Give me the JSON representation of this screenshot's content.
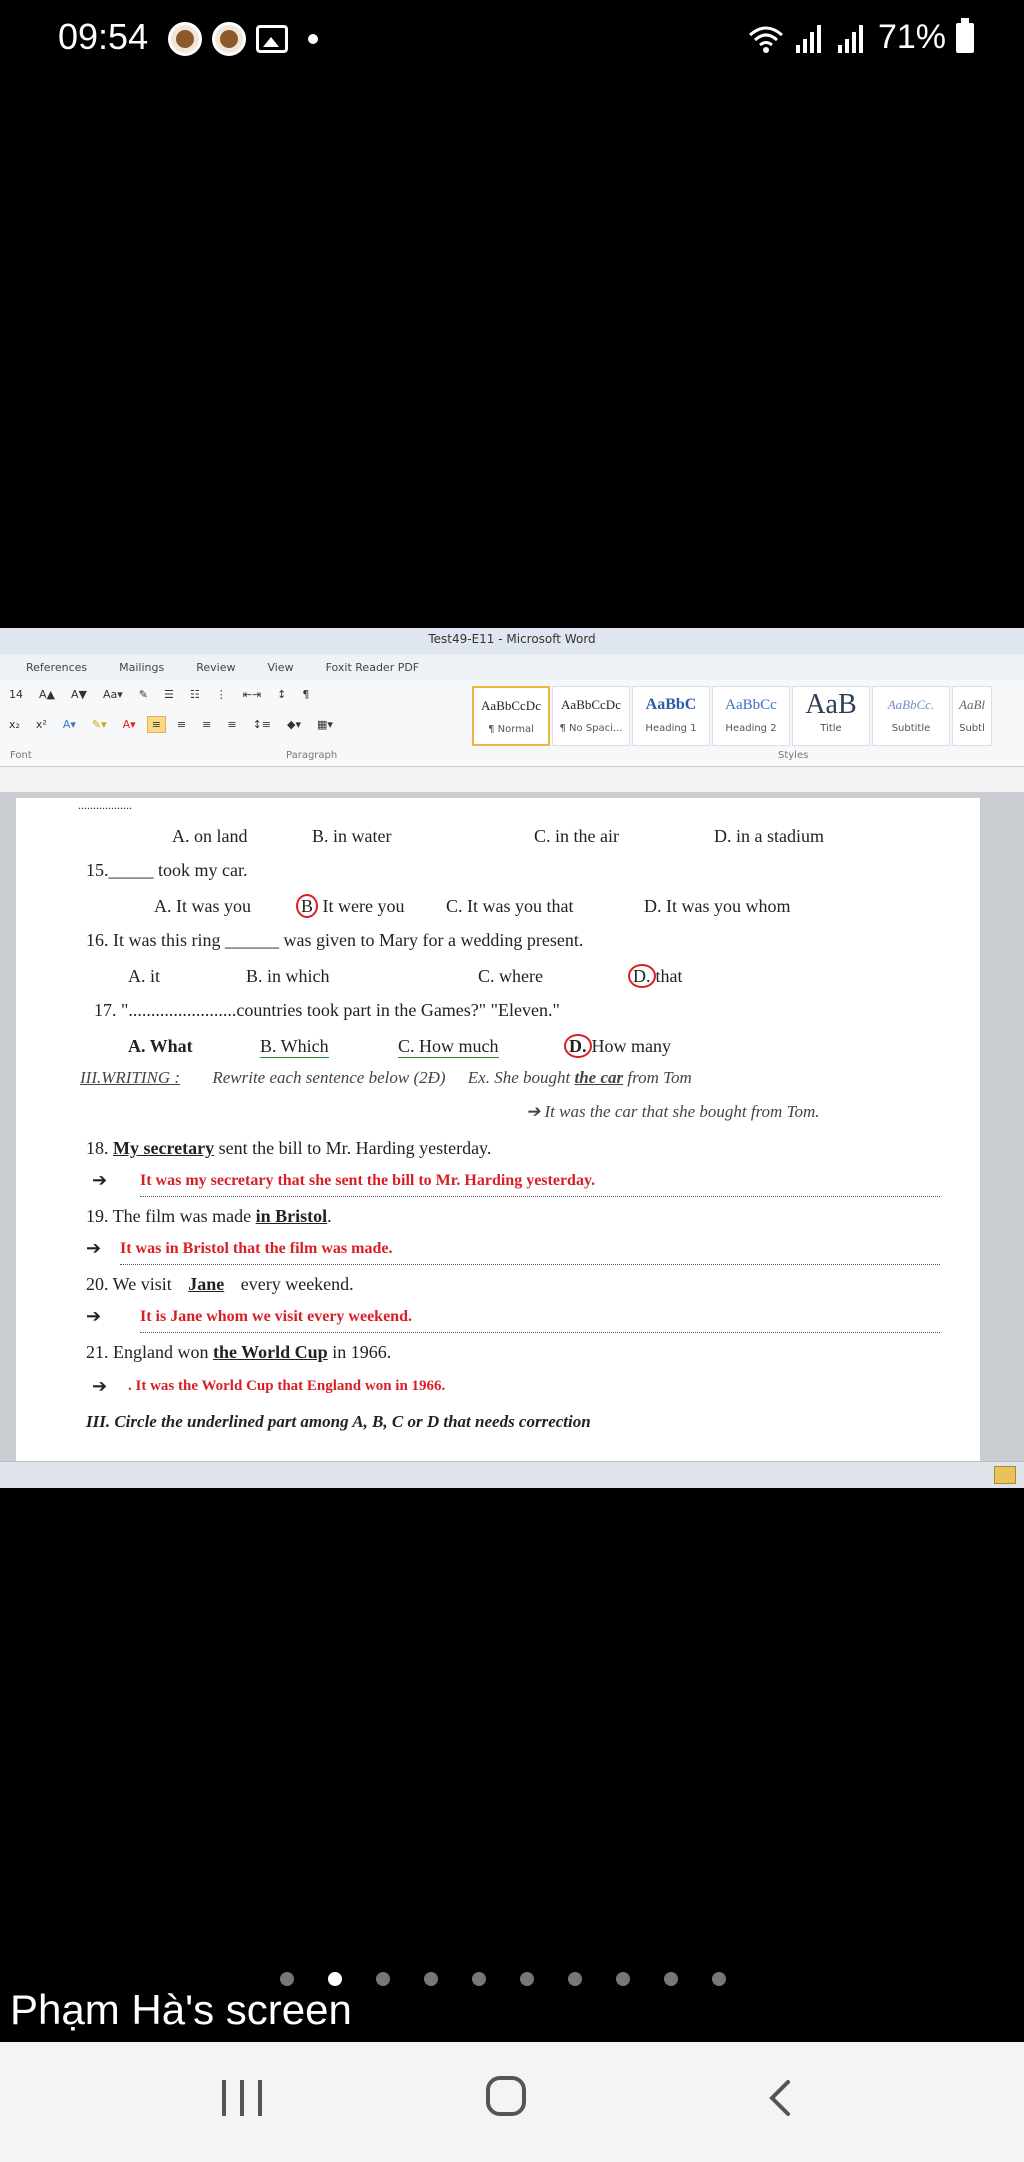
{
  "status": {
    "time": "09:54",
    "battery": "71%"
  },
  "window": {
    "title": "Test49-E11 - Microsoft Word",
    "tabs": [
      "References",
      "Mailings",
      "Review",
      "View",
      "Foxit Reader PDF"
    ],
    "ribbon": {
      "font_size": "14",
      "groups": [
        "Font",
        "Paragraph",
        "Styles"
      ],
      "styles": [
        {
          "sample": "AaBbCcDc",
          "name": "¶ Normal"
        },
        {
          "sample": "AaBbCcDc",
          "name": "¶ No Spaci..."
        },
        {
          "sample": "AaBbC",
          "name": "Heading 1"
        },
        {
          "sample": "AaBbCc",
          "name": "Heading 2"
        },
        {
          "sample": "AaB",
          "name": "Title"
        },
        {
          "sample": "AaBbCc.",
          "name": "Subtitle"
        },
        {
          "sample": "AaBl",
          "name": "Subtl"
        }
      ]
    }
  },
  "document": {
    "cursor_line": "..................",
    "q14_options": [
      "A. on land",
      "B. in water",
      "C. in the air",
      "D. in a stadium"
    ],
    "q15": {
      "num": "15.",
      "blank": "_____",
      "text": "took my car."
    },
    "q15_options": {
      "a": "A. It was you",
      "b_letter": "B",
      "b_text": "It were you",
      "c": "C. It was you that",
      "d": "D. It was you whom"
    },
    "q16": "16. It was this ring ______ was given to Mary for a wedding present.",
    "q16_options": {
      "a": "A. it",
      "b": "B. in which",
      "c": "C. where",
      "d_letter": "D.",
      "d_text": "that"
    },
    "q17": {
      "num": "17. \"",
      "dots": "........................",
      "text": "countries took part in the Games?\"  \"Eleven.\""
    },
    "q17_options": {
      "a": "A. What",
      "b": "B. Which",
      "c": "C. How much",
      "d_letter": "D.",
      "d_text": "How many"
    },
    "writing_head": "III.WRITING :",
    "writing_instr": "Rewrite each sentence below (2Đ)",
    "example": {
      "pre": "Ex. She bought",
      "under": "the car",
      "post": "from Tom"
    },
    "example_answer": "➔ It was the car that she bought from Tom.",
    "q18": {
      "num": "18.",
      "under": "My secretary",
      "rest": "sent the bill to Mr. Harding yesterday."
    },
    "q18_answer": "It was my secretary that she sent the bill to Mr. Harding yesterday.",
    "q19": {
      "pre": "19. The film was made",
      "under": "in Bristol",
      "post": "."
    },
    "q19_answer": "It was in Bristol that the film was made.",
    "q20": {
      "pre": "20. We visit",
      "under": "Jane",
      "post": "every weekend."
    },
    "q20_answer": "It is Jane whom we visit every weekend.",
    "q21": {
      "pre": "21. England won",
      "under": "the World Cup",
      "post": "in 1966."
    },
    "q21_answer": ". It was the World Cup that England won in 1966.",
    "section3": "III. Circle the underlined part among A, B, C or D that needs correction",
    "arrow": "➔"
  },
  "screen_label": "Phạm Hà's screen"
}
